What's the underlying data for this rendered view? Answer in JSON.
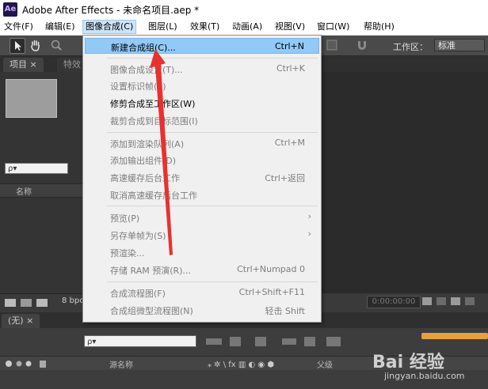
{
  "window": {
    "title": "Adobe After Effects - 未命名项目.aep *",
    "app_icon": "Ae"
  },
  "menubar": [
    {
      "label": "文件(F)"
    },
    {
      "label": "编辑(E)"
    },
    {
      "label": "图像合成(C)",
      "active": true
    },
    {
      "label": "图层(L)"
    },
    {
      "label": "效果(T)"
    },
    {
      "label": "动画(A)"
    },
    {
      "label": "视图(V)"
    },
    {
      "label": "窗口(W)"
    },
    {
      "label": "帮助(H)"
    }
  ],
  "toolbar": {
    "workspace_label": "工作区：",
    "workspace_value": "标准"
  },
  "project_panel": {
    "tabs": [
      "项目 ×",
      "特效"
    ],
    "search_placeholder": "ρ▾",
    "column_name": "名称",
    "bpc": "8 bpc"
  },
  "timeline": {
    "tab": "(无) ×",
    "search_placeholder": "ρ▾",
    "columns": [
      "源名称",
      "父级"
    ]
  },
  "dropdown": {
    "items": [
      {
        "label": "新建合成组(C)...",
        "shortcut": "Ctrl+N",
        "enabled": true,
        "highlighted": true
      },
      {
        "label": "图像合成设置(T)...",
        "shortcut": "Ctrl+K",
        "enabled": false
      },
      {
        "label": "设置标识帧(E)",
        "shortcut": "",
        "enabled": false
      },
      {
        "label": "修剪合成至工作区(W)",
        "shortcut": "",
        "enabled": true
      },
      {
        "label": "裁剪合成到目标范围(I)",
        "shortcut": "",
        "enabled": false
      },
      {
        "label": "添加到渲染队列(A)",
        "shortcut": "Ctrl+M",
        "enabled": false
      },
      {
        "label": "添加输出组件(D)",
        "shortcut": "",
        "enabled": false
      },
      {
        "label": "高速缓存后台工作",
        "shortcut": "Ctrl+返回",
        "enabled": false
      },
      {
        "label": "取消高速缓存后台工作",
        "shortcut": "",
        "enabled": false
      },
      {
        "label": "预览(P)",
        "shortcut": "",
        "enabled": false,
        "submenu": true
      },
      {
        "label": "另存单帧为(S)",
        "shortcut": "",
        "enabled": false,
        "submenu": true
      },
      {
        "label": "预渲染...",
        "shortcut": "",
        "enabled": false
      },
      {
        "label": "存储 RAM 预演(R)...",
        "shortcut": "Ctrl+Numpad 0",
        "enabled": false
      },
      {
        "label": "合成流程图(F)",
        "shortcut": "Ctrl+Shift+F11",
        "enabled": false
      },
      {
        "label": "合成组微型流程图(N)",
        "shortcut": "轻击 Shift",
        "enabled": false
      }
    ]
  },
  "watermark": {
    "brand": "Bai 经验",
    "url": "jingyan.baidu.com"
  },
  "colors": {
    "highlight": "#91c9f7",
    "annotation_arrow": "#e8312e",
    "menubar_active": "#cce4f7"
  }
}
